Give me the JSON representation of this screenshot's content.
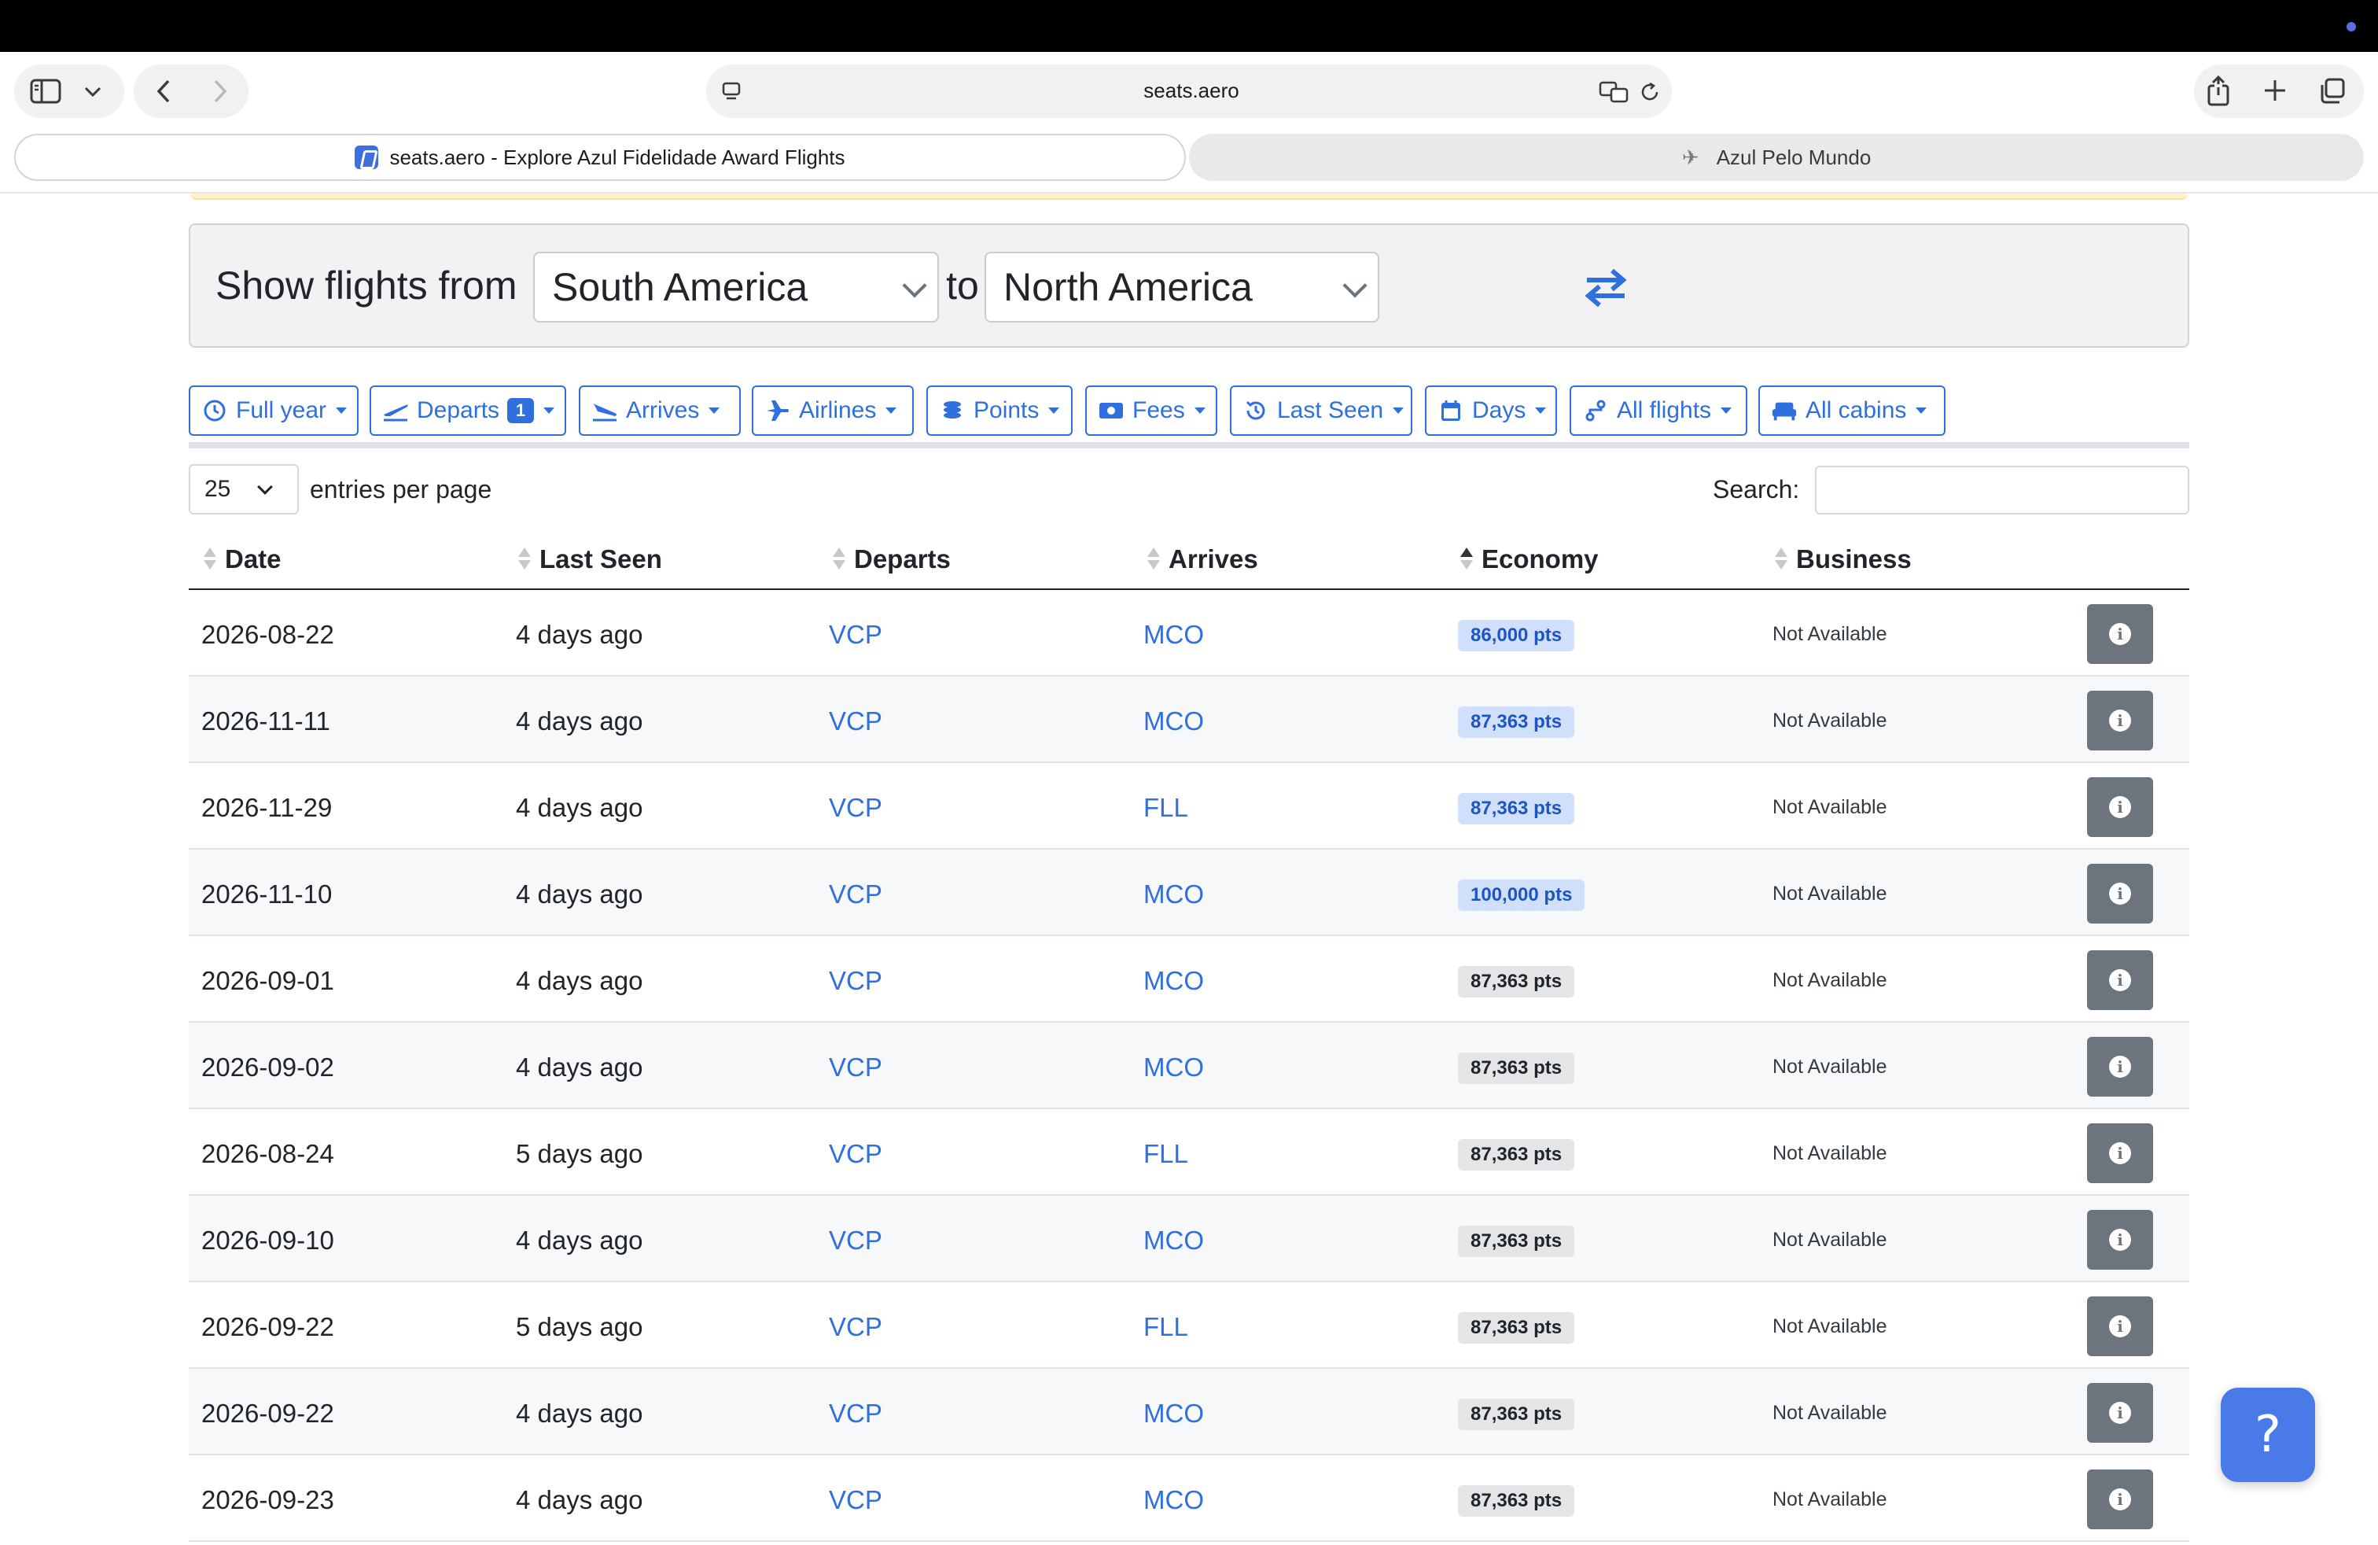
{
  "browser": {
    "url": "seats.aero",
    "tabs": [
      {
        "title": "seats.aero - Explore Azul Fidelidade Award Flights"
      },
      {
        "title": "Azul Pelo Mundo"
      }
    ]
  },
  "search_bar": {
    "prefix": "Show flights from",
    "origin": "South America",
    "connector": "to",
    "destination": "North America"
  },
  "filters": [
    {
      "label": "Full year",
      "icon": "clock-icon"
    },
    {
      "label": "Departs",
      "icon": "plane-departure-icon",
      "badge": "1"
    },
    {
      "label": "Arrives",
      "icon": "plane-arrival-icon"
    },
    {
      "label": "Airlines",
      "icon": "plane-icon"
    },
    {
      "label": "Points",
      "icon": "coins-icon"
    },
    {
      "label": "Fees",
      "icon": "money-bill-icon"
    },
    {
      "label": "Last Seen",
      "icon": "history-icon"
    },
    {
      "label": "Days",
      "icon": "calendar-icon"
    },
    {
      "label": "All flights",
      "icon": "route-icon"
    },
    {
      "label": "All cabins",
      "icon": "couch-icon"
    }
  ],
  "table_controls": {
    "entries_value": "25",
    "entries_label": "entries per page",
    "search_label": "Search:"
  },
  "columns": [
    "Date",
    "Last Seen",
    "Departs",
    "Arrives",
    "Economy",
    "Business"
  ],
  "rows": [
    {
      "date": "2026-08-22",
      "last_seen": "4 days ago",
      "departs": "VCP",
      "arrives": "MCO",
      "economy": "86,000 pts",
      "economy_style": "blue",
      "business": "Not Available"
    },
    {
      "date": "2026-11-11",
      "last_seen": "4 days ago",
      "departs": "VCP",
      "arrives": "MCO",
      "economy": "87,363 pts",
      "economy_style": "blue",
      "business": "Not Available"
    },
    {
      "date": "2026-11-29",
      "last_seen": "4 days ago",
      "departs": "VCP",
      "arrives": "FLL",
      "economy": "87,363 pts",
      "economy_style": "blue",
      "business": "Not Available"
    },
    {
      "date": "2026-11-10",
      "last_seen": "4 days ago",
      "departs": "VCP",
      "arrives": "MCO",
      "economy": "100,000 pts",
      "economy_style": "blue",
      "business": "Not Available"
    },
    {
      "date": "2026-09-01",
      "last_seen": "4 days ago",
      "departs": "VCP",
      "arrives": "MCO",
      "economy": "87,363 pts",
      "economy_style": "gray",
      "business": "Not Available"
    },
    {
      "date": "2026-09-02",
      "last_seen": "4 days ago",
      "departs": "VCP",
      "arrives": "MCO",
      "economy": "87,363 pts",
      "economy_style": "gray",
      "business": "Not Available"
    },
    {
      "date": "2026-08-24",
      "last_seen": "5 days ago",
      "departs": "VCP",
      "arrives": "FLL",
      "economy": "87,363 pts",
      "economy_style": "gray",
      "business": "Not Available"
    },
    {
      "date": "2026-09-10",
      "last_seen": "4 days ago",
      "departs": "VCP",
      "arrives": "MCO",
      "economy": "87,363 pts",
      "economy_style": "gray",
      "business": "Not Available"
    },
    {
      "date": "2026-09-22",
      "last_seen": "5 days ago",
      "departs": "VCP",
      "arrives": "FLL",
      "economy": "87,363 pts",
      "economy_style": "gray",
      "business": "Not Available"
    },
    {
      "date": "2026-09-22",
      "last_seen": "4 days ago",
      "departs": "VCP",
      "arrives": "MCO",
      "economy": "87,363 pts",
      "economy_style": "gray",
      "business": "Not Available"
    },
    {
      "date": "2026-09-23",
      "last_seen": "4 days ago",
      "departs": "VCP",
      "arrives": "MCO",
      "economy": "87,363 pts",
      "economy_style": "gray",
      "business": "Not Available"
    }
  ],
  "help": {
    "label": "?"
  },
  "colors": {
    "accent": "#2f6fde",
    "info_button": "#6c757d",
    "help_button": "#4a7ae8"
  }
}
